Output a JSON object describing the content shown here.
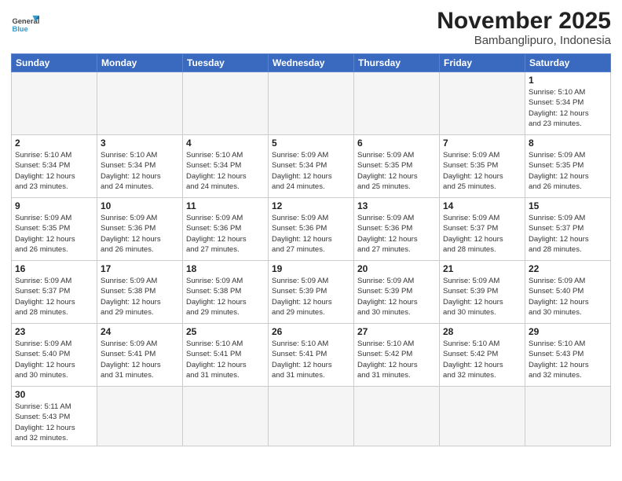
{
  "header": {
    "logo_general": "General",
    "logo_blue": "Blue",
    "month_title": "November 2025",
    "location": "Bambanglipuro, Indonesia"
  },
  "days_of_week": [
    "Sunday",
    "Monday",
    "Tuesday",
    "Wednesday",
    "Thursday",
    "Friday",
    "Saturday"
  ],
  "weeks": [
    [
      {
        "day": "",
        "info": ""
      },
      {
        "day": "",
        "info": ""
      },
      {
        "day": "",
        "info": ""
      },
      {
        "day": "",
        "info": ""
      },
      {
        "day": "",
        "info": ""
      },
      {
        "day": "",
        "info": ""
      },
      {
        "day": "1",
        "info": "Sunrise: 5:10 AM\nSunset: 5:34 PM\nDaylight: 12 hours\nand 23 minutes."
      }
    ],
    [
      {
        "day": "2",
        "info": "Sunrise: 5:10 AM\nSunset: 5:34 PM\nDaylight: 12 hours\nand 23 minutes."
      },
      {
        "day": "3",
        "info": "Sunrise: 5:10 AM\nSunset: 5:34 PM\nDaylight: 12 hours\nand 24 minutes."
      },
      {
        "day": "4",
        "info": "Sunrise: 5:10 AM\nSunset: 5:34 PM\nDaylight: 12 hours\nand 24 minutes."
      },
      {
        "day": "5",
        "info": "Sunrise: 5:09 AM\nSunset: 5:34 PM\nDaylight: 12 hours\nand 24 minutes."
      },
      {
        "day": "6",
        "info": "Sunrise: 5:09 AM\nSunset: 5:35 PM\nDaylight: 12 hours\nand 25 minutes."
      },
      {
        "day": "7",
        "info": "Sunrise: 5:09 AM\nSunset: 5:35 PM\nDaylight: 12 hours\nand 25 minutes."
      },
      {
        "day": "8",
        "info": "Sunrise: 5:09 AM\nSunset: 5:35 PM\nDaylight: 12 hours\nand 26 minutes."
      }
    ],
    [
      {
        "day": "9",
        "info": "Sunrise: 5:09 AM\nSunset: 5:35 PM\nDaylight: 12 hours\nand 26 minutes."
      },
      {
        "day": "10",
        "info": "Sunrise: 5:09 AM\nSunset: 5:36 PM\nDaylight: 12 hours\nand 26 minutes."
      },
      {
        "day": "11",
        "info": "Sunrise: 5:09 AM\nSunset: 5:36 PM\nDaylight: 12 hours\nand 27 minutes."
      },
      {
        "day": "12",
        "info": "Sunrise: 5:09 AM\nSunset: 5:36 PM\nDaylight: 12 hours\nand 27 minutes."
      },
      {
        "day": "13",
        "info": "Sunrise: 5:09 AM\nSunset: 5:36 PM\nDaylight: 12 hours\nand 27 minutes."
      },
      {
        "day": "14",
        "info": "Sunrise: 5:09 AM\nSunset: 5:37 PM\nDaylight: 12 hours\nand 28 minutes."
      },
      {
        "day": "15",
        "info": "Sunrise: 5:09 AM\nSunset: 5:37 PM\nDaylight: 12 hours\nand 28 minutes."
      }
    ],
    [
      {
        "day": "16",
        "info": "Sunrise: 5:09 AM\nSunset: 5:37 PM\nDaylight: 12 hours\nand 28 minutes."
      },
      {
        "day": "17",
        "info": "Sunrise: 5:09 AM\nSunset: 5:38 PM\nDaylight: 12 hours\nand 29 minutes."
      },
      {
        "day": "18",
        "info": "Sunrise: 5:09 AM\nSunset: 5:38 PM\nDaylight: 12 hours\nand 29 minutes."
      },
      {
        "day": "19",
        "info": "Sunrise: 5:09 AM\nSunset: 5:39 PM\nDaylight: 12 hours\nand 29 minutes."
      },
      {
        "day": "20",
        "info": "Sunrise: 5:09 AM\nSunset: 5:39 PM\nDaylight: 12 hours\nand 30 minutes."
      },
      {
        "day": "21",
        "info": "Sunrise: 5:09 AM\nSunset: 5:39 PM\nDaylight: 12 hours\nand 30 minutes."
      },
      {
        "day": "22",
        "info": "Sunrise: 5:09 AM\nSunset: 5:40 PM\nDaylight: 12 hours\nand 30 minutes."
      }
    ],
    [
      {
        "day": "23",
        "info": "Sunrise: 5:09 AM\nSunset: 5:40 PM\nDaylight: 12 hours\nand 30 minutes."
      },
      {
        "day": "24",
        "info": "Sunrise: 5:09 AM\nSunset: 5:41 PM\nDaylight: 12 hours\nand 31 minutes."
      },
      {
        "day": "25",
        "info": "Sunrise: 5:10 AM\nSunset: 5:41 PM\nDaylight: 12 hours\nand 31 minutes."
      },
      {
        "day": "26",
        "info": "Sunrise: 5:10 AM\nSunset: 5:41 PM\nDaylight: 12 hours\nand 31 minutes."
      },
      {
        "day": "27",
        "info": "Sunrise: 5:10 AM\nSunset: 5:42 PM\nDaylight: 12 hours\nand 31 minutes."
      },
      {
        "day": "28",
        "info": "Sunrise: 5:10 AM\nSunset: 5:42 PM\nDaylight: 12 hours\nand 32 minutes."
      },
      {
        "day": "29",
        "info": "Sunrise: 5:10 AM\nSunset: 5:43 PM\nDaylight: 12 hours\nand 32 minutes."
      }
    ],
    [
      {
        "day": "30",
        "info": "Sunrise: 5:11 AM\nSunset: 5:43 PM\nDaylight: 12 hours\nand 32 minutes."
      },
      {
        "day": "",
        "info": ""
      },
      {
        "day": "",
        "info": ""
      },
      {
        "day": "",
        "info": ""
      },
      {
        "day": "",
        "info": ""
      },
      {
        "day": "",
        "info": ""
      },
      {
        "day": "",
        "info": ""
      }
    ]
  ]
}
